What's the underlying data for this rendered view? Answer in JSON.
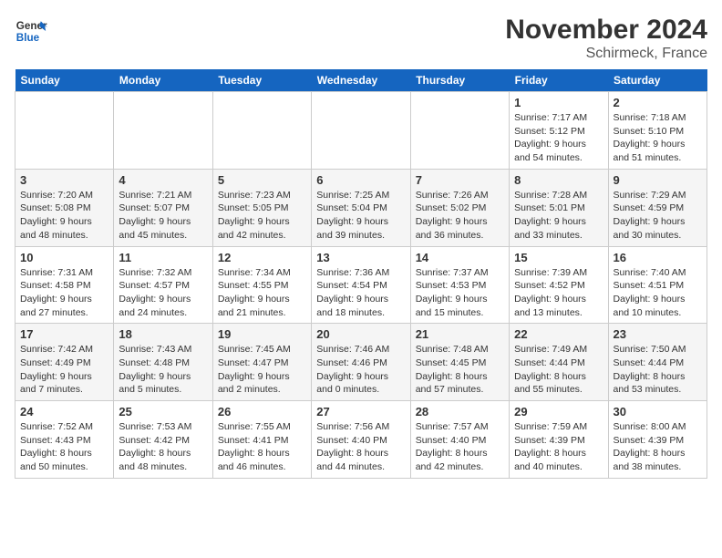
{
  "header": {
    "logo_line1": "General",
    "logo_line2": "Blue",
    "month": "November 2024",
    "location": "Schirmeck, France"
  },
  "days_of_week": [
    "Sunday",
    "Monday",
    "Tuesday",
    "Wednesday",
    "Thursday",
    "Friday",
    "Saturday"
  ],
  "weeks": [
    [
      {
        "day": "",
        "sunrise": "",
        "sunset": "",
        "daylight": ""
      },
      {
        "day": "",
        "sunrise": "",
        "sunset": "",
        "daylight": ""
      },
      {
        "day": "",
        "sunrise": "",
        "sunset": "",
        "daylight": ""
      },
      {
        "day": "",
        "sunrise": "",
        "sunset": "",
        "daylight": ""
      },
      {
        "day": "",
        "sunrise": "",
        "sunset": "",
        "daylight": ""
      },
      {
        "day": "1",
        "sunrise": "Sunrise: 7:17 AM",
        "sunset": "Sunset: 5:12 PM",
        "daylight": "Daylight: 9 hours and 54 minutes."
      },
      {
        "day": "2",
        "sunrise": "Sunrise: 7:18 AM",
        "sunset": "Sunset: 5:10 PM",
        "daylight": "Daylight: 9 hours and 51 minutes."
      }
    ],
    [
      {
        "day": "3",
        "sunrise": "Sunrise: 7:20 AM",
        "sunset": "Sunset: 5:08 PM",
        "daylight": "Daylight: 9 hours and 48 minutes."
      },
      {
        "day": "4",
        "sunrise": "Sunrise: 7:21 AM",
        "sunset": "Sunset: 5:07 PM",
        "daylight": "Daylight: 9 hours and 45 minutes."
      },
      {
        "day": "5",
        "sunrise": "Sunrise: 7:23 AM",
        "sunset": "Sunset: 5:05 PM",
        "daylight": "Daylight: 9 hours and 42 minutes."
      },
      {
        "day": "6",
        "sunrise": "Sunrise: 7:25 AM",
        "sunset": "Sunset: 5:04 PM",
        "daylight": "Daylight: 9 hours and 39 minutes."
      },
      {
        "day": "7",
        "sunrise": "Sunrise: 7:26 AM",
        "sunset": "Sunset: 5:02 PM",
        "daylight": "Daylight: 9 hours and 36 minutes."
      },
      {
        "day": "8",
        "sunrise": "Sunrise: 7:28 AM",
        "sunset": "Sunset: 5:01 PM",
        "daylight": "Daylight: 9 hours and 33 minutes."
      },
      {
        "day": "9",
        "sunrise": "Sunrise: 7:29 AM",
        "sunset": "Sunset: 4:59 PM",
        "daylight": "Daylight: 9 hours and 30 minutes."
      }
    ],
    [
      {
        "day": "10",
        "sunrise": "Sunrise: 7:31 AM",
        "sunset": "Sunset: 4:58 PM",
        "daylight": "Daylight: 9 hours and 27 minutes."
      },
      {
        "day": "11",
        "sunrise": "Sunrise: 7:32 AM",
        "sunset": "Sunset: 4:57 PM",
        "daylight": "Daylight: 9 hours and 24 minutes."
      },
      {
        "day": "12",
        "sunrise": "Sunrise: 7:34 AM",
        "sunset": "Sunset: 4:55 PM",
        "daylight": "Daylight: 9 hours and 21 minutes."
      },
      {
        "day": "13",
        "sunrise": "Sunrise: 7:36 AM",
        "sunset": "Sunset: 4:54 PM",
        "daylight": "Daylight: 9 hours and 18 minutes."
      },
      {
        "day": "14",
        "sunrise": "Sunrise: 7:37 AM",
        "sunset": "Sunset: 4:53 PM",
        "daylight": "Daylight: 9 hours and 15 minutes."
      },
      {
        "day": "15",
        "sunrise": "Sunrise: 7:39 AM",
        "sunset": "Sunset: 4:52 PM",
        "daylight": "Daylight: 9 hours and 13 minutes."
      },
      {
        "day": "16",
        "sunrise": "Sunrise: 7:40 AM",
        "sunset": "Sunset: 4:51 PM",
        "daylight": "Daylight: 9 hours and 10 minutes."
      }
    ],
    [
      {
        "day": "17",
        "sunrise": "Sunrise: 7:42 AM",
        "sunset": "Sunset: 4:49 PM",
        "daylight": "Daylight: 9 hours and 7 minutes."
      },
      {
        "day": "18",
        "sunrise": "Sunrise: 7:43 AM",
        "sunset": "Sunset: 4:48 PM",
        "daylight": "Daylight: 9 hours and 5 minutes."
      },
      {
        "day": "19",
        "sunrise": "Sunrise: 7:45 AM",
        "sunset": "Sunset: 4:47 PM",
        "daylight": "Daylight: 9 hours and 2 minutes."
      },
      {
        "day": "20",
        "sunrise": "Sunrise: 7:46 AM",
        "sunset": "Sunset: 4:46 PM",
        "daylight": "Daylight: 9 hours and 0 minutes."
      },
      {
        "day": "21",
        "sunrise": "Sunrise: 7:48 AM",
        "sunset": "Sunset: 4:45 PM",
        "daylight": "Daylight: 8 hours and 57 minutes."
      },
      {
        "day": "22",
        "sunrise": "Sunrise: 7:49 AM",
        "sunset": "Sunset: 4:44 PM",
        "daylight": "Daylight: 8 hours and 55 minutes."
      },
      {
        "day": "23",
        "sunrise": "Sunrise: 7:50 AM",
        "sunset": "Sunset: 4:44 PM",
        "daylight": "Daylight: 8 hours and 53 minutes."
      }
    ],
    [
      {
        "day": "24",
        "sunrise": "Sunrise: 7:52 AM",
        "sunset": "Sunset: 4:43 PM",
        "daylight": "Daylight: 8 hours and 50 minutes."
      },
      {
        "day": "25",
        "sunrise": "Sunrise: 7:53 AM",
        "sunset": "Sunset: 4:42 PM",
        "daylight": "Daylight: 8 hours and 48 minutes."
      },
      {
        "day": "26",
        "sunrise": "Sunrise: 7:55 AM",
        "sunset": "Sunset: 4:41 PM",
        "daylight": "Daylight: 8 hours and 46 minutes."
      },
      {
        "day": "27",
        "sunrise": "Sunrise: 7:56 AM",
        "sunset": "Sunset: 4:40 PM",
        "daylight": "Daylight: 8 hours and 44 minutes."
      },
      {
        "day": "28",
        "sunrise": "Sunrise: 7:57 AM",
        "sunset": "Sunset: 4:40 PM",
        "daylight": "Daylight: 8 hours and 42 minutes."
      },
      {
        "day": "29",
        "sunrise": "Sunrise: 7:59 AM",
        "sunset": "Sunset: 4:39 PM",
        "daylight": "Daylight: 8 hours and 40 minutes."
      },
      {
        "day": "30",
        "sunrise": "Sunrise: 8:00 AM",
        "sunset": "Sunset: 4:39 PM",
        "daylight": "Daylight: 8 hours and 38 minutes."
      }
    ]
  ]
}
